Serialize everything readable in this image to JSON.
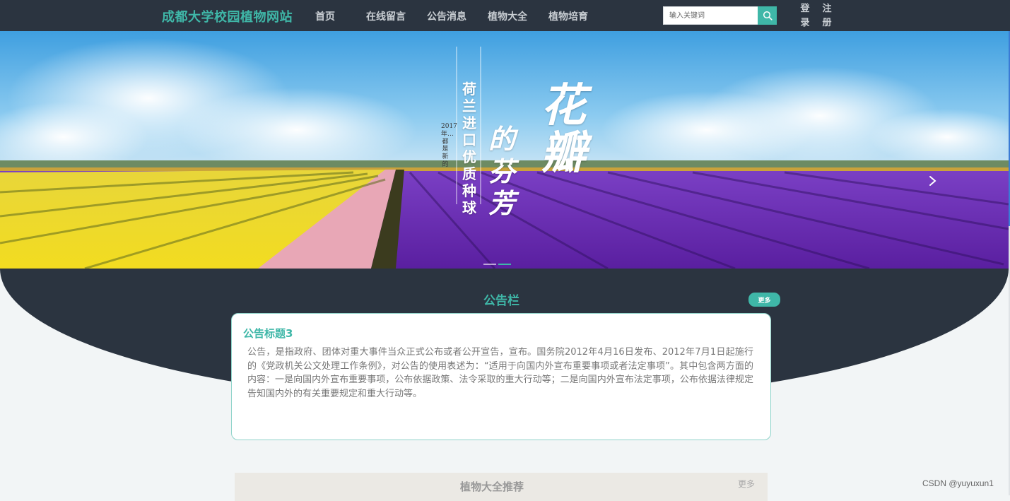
{
  "header": {
    "brand": "成都大学校园植物网站",
    "nav": [
      {
        "label": "首页"
      },
      {
        "label": "在线留言"
      },
      {
        "label": "公告消息"
      },
      {
        "label": "植物大全"
      },
      {
        "label": "植物培育"
      }
    ],
    "search": {
      "placeholder": "输入关键词",
      "value": ""
    },
    "login_label": "登录",
    "register_label": "注册"
  },
  "banner": {
    "vertical_line_1": "荷兰进口优质种球",
    "vertical_small": "2017年…都是新的",
    "vertical_line_2": "的芬芳",
    "vertical_line_3": "花瓣",
    "slide_count": 2,
    "active_slide": 1
  },
  "notice": {
    "section_title": "公告栏",
    "more_label": "更多",
    "card_title": "公告标题3",
    "card_body": "公告，是指政府、团体对重大事件当众正式公布或者公开宣告，宣布。国务院2012年4月16日发布、2012年7月1日起施行的《党政机关公文处理工作条例》，对公告的使用表述为：“适用于向国内外宣布重要事项或者法定事项”。其中包含两方面的内容：一是向国内外宣布重要事项，公布依据政策、法令采取的重大行动等；二是向国内外宣布法定事项，公布依据法律规定告知国内外的有关重要规定和重大行动等。"
  },
  "recommend": {
    "title": "植物大全推荐",
    "more_label": "更多"
  },
  "watermark": "CSDN @yuyuxun1",
  "colors": {
    "accent": "#3fb7a8",
    "header_bg": "#2b3440"
  }
}
